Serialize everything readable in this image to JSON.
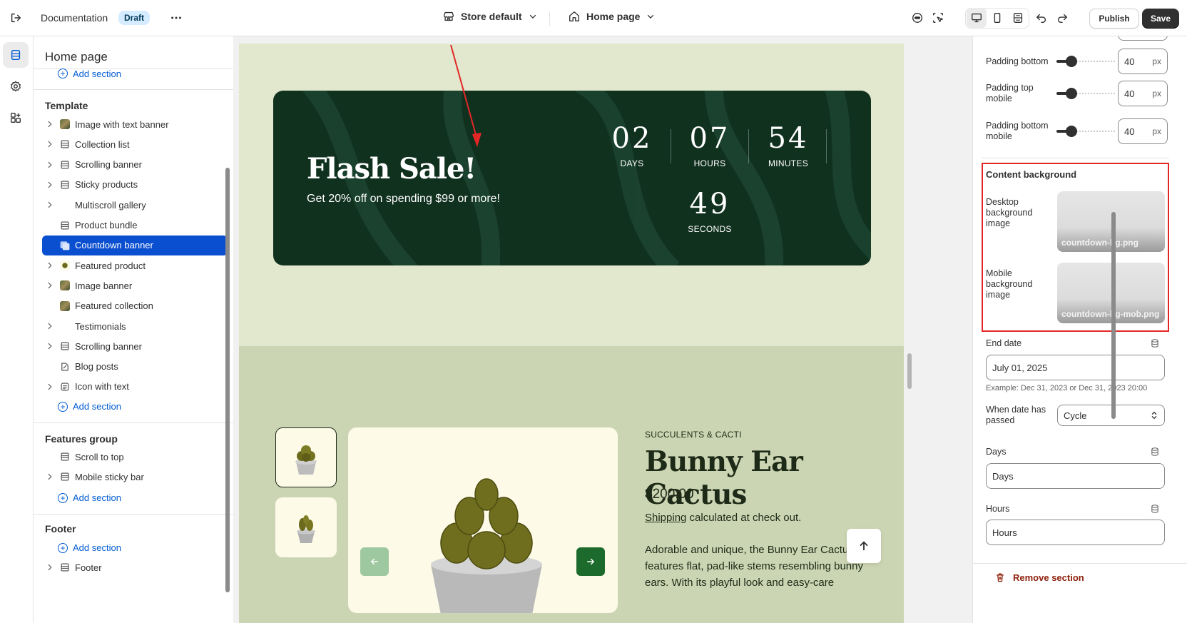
{
  "topbar": {
    "exit_label": "Exit",
    "theme_name": "Documentation",
    "status_badge": "Draft",
    "store_selector": "Store default",
    "page_selector": "Home page",
    "publish_label": "Publish",
    "save_label": "Save"
  },
  "left_panel": {
    "title": "Home page",
    "header_add_section": "Add section",
    "template_group": {
      "title": "Template",
      "items": [
        {
          "label": "Image with text banner",
          "icon": "image-thumb-icon",
          "has_chevron": true
        },
        {
          "label": "Collection list",
          "icon": "section-icon",
          "has_chevron": true
        },
        {
          "label": "Scrolling banner",
          "icon": "section-icon",
          "has_chevron": true
        },
        {
          "label": "Sticky products",
          "icon": "section-icon",
          "has_chevron": true
        },
        {
          "label": "Multiscroll gallery",
          "icon": "none",
          "has_chevron": true
        },
        {
          "label": "Product bundle",
          "icon": "section-icon",
          "has_chevron": false
        },
        {
          "label": "Countdown banner",
          "icon": "countdown-icon",
          "has_chevron": false,
          "selected": true
        },
        {
          "label": "Featured product",
          "icon": "product-thumb-icon",
          "has_chevron": true
        },
        {
          "label": "Image banner",
          "icon": "image-thumb-icon",
          "has_chevron": true
        },
        {
          "label": "Featured collection",
          "icon": "image-thumb-icon",
          "has_chevron": false
        },
        {
          "label": "Testimonials",
          "icon": "none",
          "has_chevron": true
        },
        {
          "label": "Scrolling banner",
          "icon": "section-icon",
          "has_chevron": true
        },
        {
          "label": "Blog posts",
          "icon": "blog-icon",
          "has_chevron": false
        },
        {
          "label": "Icon with text",
          "icon": "text-icon",
          "has_chevron": true
        }
      ],
      "add_section": "Add section"
    },
    "features_group": {
      "title": "Features group",
      "items": [
        {
          "label": "Scroll to top",
          "icon": "section-icon",
          "has_chevron": false
        },
        {
          "label": "Mobile sticky bar",
          "icon": "section-icon",
          "has_chevron": true
        }
      ],
      "add_section": "Add section"
    },
    "footer_group": {
      "title": "Footer",
      "add_section": "Add section",
      "items": [
        {
          "label": "Footer",
          "icon": "section-icon",
          "has_chevron": true
        }
      ]
    }
  },
  "preview": {
    "banner": {
      "title": "Flash Sale!",
      "subtitle": "Get 20% off on spending $99 or more!",
      "countdown": [
        {
          "value": "02",
          "label": "DAYS"
        },
        {
          "value": "07",
          "label": "HOURS"
        },
        {
          "value": "54",
          "label": "MINUTES"
        },
        {
          "value": "49",
          "label": "SECONDS"
        }
      ]
    },
    "product": {
      "category": "SUCCULENTS & CACTI",
      "title": "Bunny Ear Cactus",
      "price": "$200.00",
      "shipping_link": "Shipping",
      "shipping_text": " calculated at check out.",
      "description": "Adorable and unique, the Bunny Ear Cactus features flat, pad-like stems resembling bunny ears. With its playful look and easy-care"
    }
  },
  "right_panel": {
    "padding_bottom": {
      "label": "Padding bottom",
      "value": "40",
      "unit": "px"
    },
    "padding_top_mobile": {
      "label": "Padding top mobile",
      "value": "40",
      "unit": "px"
    },
    "padding_bottom_mobile": {
      "label": "Padding bottom mobile",
      "value": "40",
      "unit": "px"
    },
    "content_background": {
      "title": "Content background",
      "desktop_label": "Desktop background image",
      "desktop_file": "countdown-bg.png",
      "mobile_label": "Mobile background image",
      "mobile_file": "countdown-bg-mob.png"
    },
    "end_date": {
      "label": "End date",
      "value": "July 01, 2025",
      "hint": "Example: Dec 31, 2023 or Dec 31, 2023 20:00"
    },
    "when_passed": {
      "label": "When date has passed",
      "value": "Cycle"
    },
    "days": {
      "label": "Days",
      "value": "Days"
    },
    "hours": {
      "label": "Hours",
      "value": "Hours"
    },
    "remove_section": "Remove section"
  },
  "colors": {
    "accent_blue": "#0a4fcf",
    "link_blue": "#005bd3",
    "banner_green": "#11311f",
    "page_bg": "#e2e8cd",
    "product_bg": "#ccd5b3",
    "highlight_red": "#e32727",
    "danger": "#8e1f0b"
  }
}
